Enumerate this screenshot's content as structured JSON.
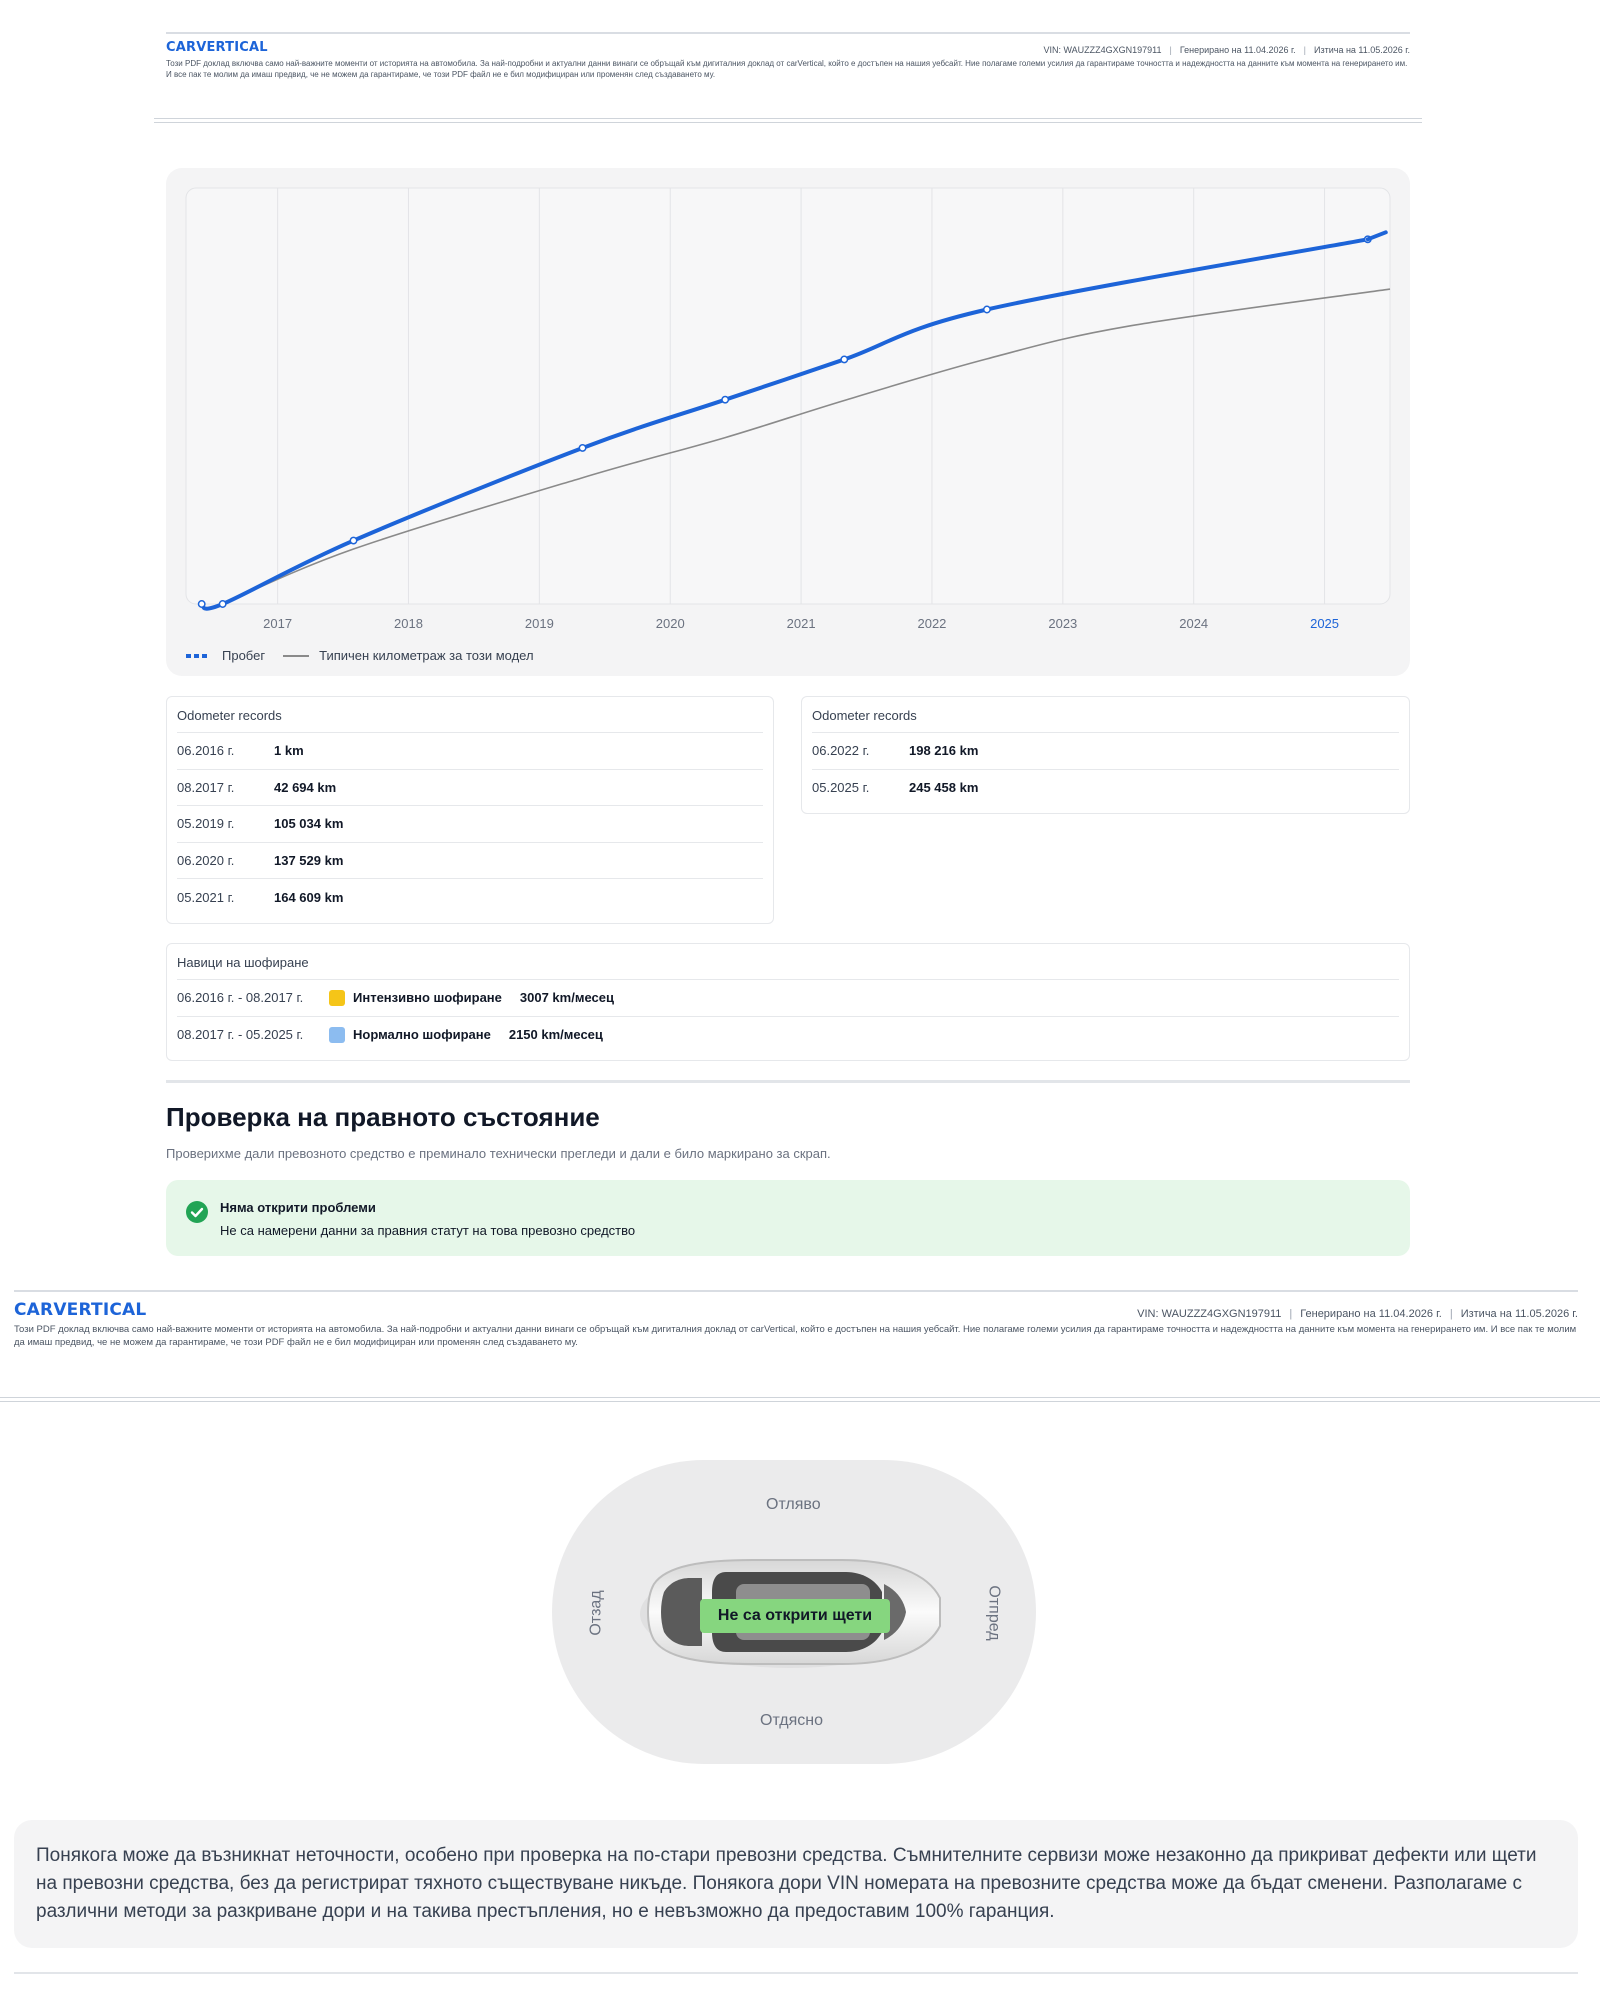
{
  "header": {
    "logo": "CARVERTICAL",
    "vin": "VIN: WAUZZZ4GXGN197911",
    "generated": "Генерирано на 11.04.2026 г.",
    "expires": "Изтича на 11.05.2026 г.",
    "disclaimer": "Този PDF доклад включва само най-важните моменти от историята на автомобила. За най-подробни и актуални данни винаги се обръщай към дигиталния доклад от carVertical, който е достъпен на нашия уебсайт. Ние полагаме големи усилия да гарантираме точността и надеждността на данните към момента на генерирането им. И все пак те молим да имаш предвид, че не можем да гарантираме, че този PDF файл не е бил модифициран или променян след създаването му."
  },
  "chart_data": {
    "type": "line",
    "x_ticks": [
      "2017",
      "2018",
      "2019",
      "2020",
      "2021",
      "2022",
      "2023",
      "2024",
      "2025"
    ],
    "highlight_tick": "2025",
    "xlim": [
      2016.3,
      2025.5
    ],
    "ylim": [
      0,
      280000
    ],
    "grid": "vertical",
    "legend_position": "bottom-left",
    "series": [
      {
        "name": "Пробег",
        "color": "#1d64d8",
        "style": "dashed-marker",
        "x": [
          2016.42,
          2016.58,
          2017.58,
          2019.33,
          2020.42,
          2021.33,
          2022.42,
          2025.33
        ],
        "y": [
          1,
          1,
          42694,
          105034,
          137529,
          164609,
          198216,
          245458
        ]
      },
      {
        "name": "Типичен километраж за този модел",
        "color": "#8a8a8a",
        "style": "solid",
        "x": [
          2016.58,
          2017.58,
          2019.33,
          2020.42,
          2021.33,
          2022.42,
          2023.5,
          2025.5
        ],
        "y": [
          1,
          37000,
          85000,
          112000,
          137000,
          165000,
          187000,
          212000
        ]
      }
    ]
  },
  "odometer_left": {
    "title": "Odometer records",
    "rows": [
      {
        "date": "06.2016 г.",
        "km": "1 km"
      },
      {
        "date": "08.2017 г.",
        "km": "42 694 km"
      },
      {
        "date": "05.2019 г.",
        "km": "105 034 km"
      },
      {
        "date": "06.2020 г.",
        "km": "137 529 km"
      },
      {
        "date": "05.2021 г.",
        "km": "164 609 km"
      }
    ]
  },
  "odometer_right": {
    "title": "Odometer records",
    "rows": [
      {
        "date": "06.2022 г.",
        "km": "198 216 km"
      },
      {
        "date": "05.2025 г.",
        "km": "245 458 km"
      }
    ]
  },
  "habits": {
    "title": "Навици на шофиране",
    "rows": [
      {
        "range": "06.2016 г. - 08.2017 г.",
        "color": "#f5c518",
        "label": "Интензивно шофиране",
        "rate": "3007 km/месец"
      },
      {
        "range": "08.2017 г. - 05.2025 г.",
        "color": "#8cbcf0",
        "label": "Нормално шофиране",
        "rate": "2150 km/месец"
      }
    ]
  },
  "legal": {
    "title": "Проверка на правното състояние",
    "subtitle": "Проверихме дали превозното средство е преминало технически прегледи и дали е било маркирано за скрап.",
    "status_title": "Няма открити проблеми",
    "status_text": "Не са намерени данни за правния статут на това превозно средство",
    "status_color": "#22a455"
  },
  "damage": {
    "top": "Отляво",
    "bottom": "Отдясно",
    "left": "Отзад",
    "right": "Отпред",
    "badge": "Не са открити щети"
  },
  "note": "Понякога може да възникнат неточности, особено при проверка на по-стари превозни средства. Съмнителните сервизи може незаконно да прикриват дефекти или щети на превозни средства, без да регистрират тяхното съществуване никъде. Понякога дори VIN номерата на превозните средства може да бъдат сменени. Разполагаме с различни методи за разкриване дори и на такива престъпления, но е невъзможно да предоставим 100% гаранция."
}
